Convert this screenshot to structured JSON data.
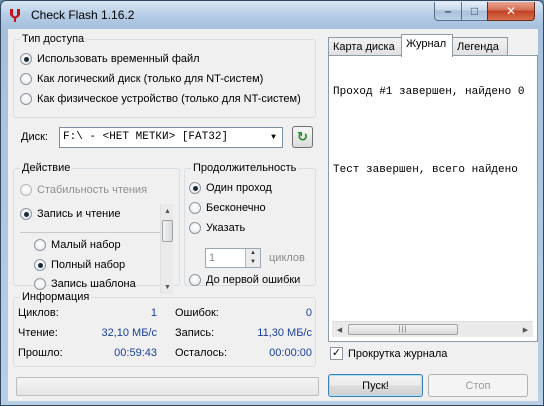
{
  "window": {
    "title": "Check Flash 1.16.2",
    "minimize": "–",
    "maximize": "□",
    "close": "✕"
  },
  "access": {
    "legend": "Тип доступа",
    "options": [
      {
        "label": "Использовать временный файл",
        "selected": true
      },
      {
        "label": "Как логический диск (только для NT-систем)",
        "selected": false
      },
      {
        "label": "Как физическое устройство (только для NT-систем)",
        "selected": false
      }
    ]
  },
  "disk": {
    "label": "Диск:",
    "value": "F:\\ - <НЕТ МЕТКИ> [FAT32]",
    "refresh": "↻"
  },
  "action": {
    "legend": "Действие",
    "options": [
      {
        "label": "Стабильность чтения",
        "selected": false,
        "disabled": true
      },
      {
        "label": "Запись и чтение",
        "selected": true,
        "disabled": false
      }
    ],
    "sub_options": [
      {
        "label": "Малый набор",
        "selected": false
      },
      {
        "label": "Полный набор",
        "selected": true
      },
      {
        "label": "Запись шаблона",
        "selected": false
      }
    ]
  },
  "duration": {
    "legend": "Продолжительность",
    "options": [
      {
        "label": "Один проход",
        "selected": true
      },
      {
        "label": "Бесконечно",
        "selected": false
      },
      {
        "label": "Указать",
        "selected": false
      }
    ],
    "cycles_value": "1",
    "cycles_label": "циклов",
    "until_error": {
      "label": "До первой ошибки",
      "selected": false
    }
  },
  "info": {
    "legend": "Информация",
    "cycles_label": "Циклов:",
    "cycles_value": "1",
    "errors_label": "Ошибок:",
    "errors_value": "0",
    "read_label": "Чтение:",
    "read_value": "32,10 МБ/с",
    "write_label": "Запись:",
    "write_value": "11,30 МБ/с",
    "elapsed_label": "Прошло:",
    "elapsed_value": "00:59:43",
    "remaining_label": "Осталось:",
    "remaining_value": "00:00:00"
  },
  "progress": {
    "value": 0
  },
  "tabs": [
    {
      "label": "Карта диска",
      "active": false
    },
    {
      "label": "Журнал",
      "active": true
    },
    {
      "label": "Легенда",
      "active": false
    }
  ],
  "log": {
    "lines": [
      "Проход #1 завершен, найдено 0",
      "",
      "Тест завершен, всего найдено"
    ]
  },
  "scroll_log": {
    "label": "Прокрутка журнала",
    "checked": true
  },
  "buttons": {
    "start": "Пуск!",
    "stop": "Стоп"
  },
  "colors": {
    "accent_value": "#1a3f9c",
    "progress_fill": "#4bbf4b"
  }
}
